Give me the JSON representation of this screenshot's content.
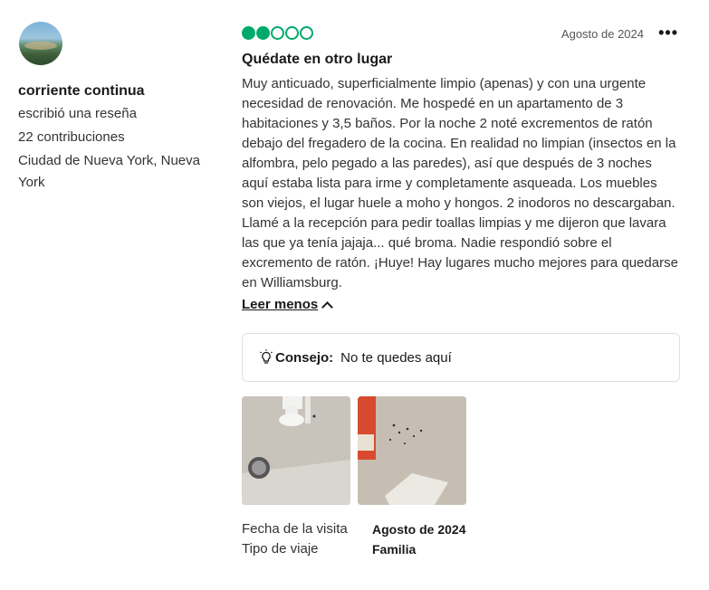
{
  "reviewer": {
    "name": "corriente continua",
    "action": "escribió una reseña",
    "contributions": "22 contribuciones",
    "location": "Ciudad de Nueva York, Nueva York"
  },
  "review": {
    "rating": 2,
    "rating_max": 5,
    "rating_color": "#00aa6c",
    "date": "Agosto de 2024",
    "title": "Quédate en otro lugar",
    "text": "Muy anticuado, superficialmente limpio (apenas) y con una urgente necesidad de renovación. Me hospedé en un apartamento de 3 habitaciones y 3,5 baños. Por la noche 2 noté excrementos de ratón debajo del fregadero de la cocina. En realidad no limpian (insectos en la alfombra, pelo pegado a las paredes), así que después de 3 noches aquí estaba lista para irme y completamente asqueada. Los muebles son viejos, el lugar huele a moho y hongos. 2 inodoros no descargaban. Llamé a la recepción para pedir toallas limpias y me dijeron que lavara las que ya tenía jajaja... qué broma. Nadie respondió sobre el excremento de ratón. ¡Huye! Hay lugares mucho mejores para quedarse en Williamsburg.",
    "read_less": "Leer menos",
    "tip_label": "Consejo:",
    "tip_text": "No te quedes aquí",
    "photos": [
      "photo-1",
      "photo-2"
    ],
    "visit_date_label": "Fecha de la visita",
    "visit_date": "Agosto de 2024",
    "trip_type_label": "Tipo de viaje",
    "trip_type": "Familia"
  }
}
